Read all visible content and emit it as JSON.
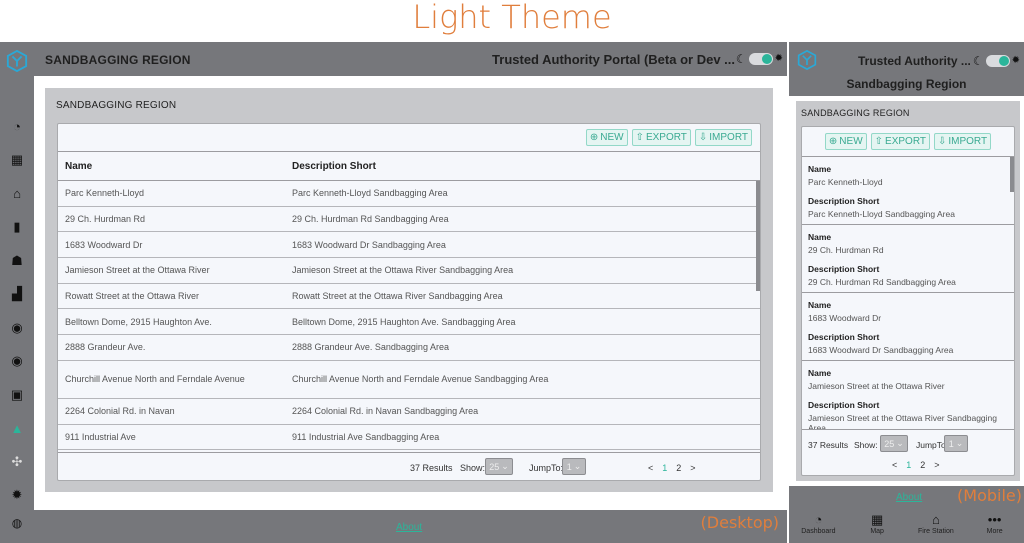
{
  "caption": "Light Theme",
  "desktop": {
    "header_title": "SANDBAGGING REGION",
    "portal_title": "Trusted Authority Portal (Beta or Dev ...",
    "theme_toggle": {
      "left_icon": "moon-icon",
      "right_icon": "sun-icon",
      "state": "light"
    },
    "sidebar": {
      "logo": "hex-y-logo",
      "items": [
        {
          "name": "dashboard",
          "icon": "speedometer-icon",
          "glyph": "◔"
        },
        {
          "name": "map",
          "icon": "map-icon",
          "glyph": "▦"
        },
        {
          "name": "fire-station",
          "icon": "fire-station-icon",
          "glyph": "⌂"
        },
        {
          "name": "fuel",
          "icon": "fuel-pump-icon",
          "glyph": "▮"
        },
        {
          "name": "people",
          "icon": "hand-people-icon",
          "glyph": "☗"
        },
        {
          "name": "city",
          "icon": "city-icon",
          "glyph": "▟"
        },
        {
          "name": "water",
          "icon": "water-drop-icon",
          "glyph": "◉"
        },
        {
          "name": "view",
          "icon": "eye-icon",
          "glyph": "◉"
        },
        {
          "name": "facility",
          "icon": "building-icon",
          "glyph": "▣"
        },
        {
          "name": "sandbagging",
          "icon": "sandbag-icon",
          "glyph": "▲",
          "active": true
        },
        {
          "name": "network",
          "icon": "network-icon",
          "glyph": "✣"
        },
        {
          "name": "settings",
          "icon": "gear-icon",
          "glyph": "✹"
        }
      ],
      "user_icon": "user-circle-icon",
      "user_glyph": "◍"
    },
    "card_title": "SANDBAGGING REGION",
    "buttons": {
      "new": "NEW",
      "export": "EXPORT",
      "import": "IMPORT",
      "new_glyph": "⊕",
      "export_glyph": "⇧",
      "import_glyph": "⇩"
    },
    "columns": {
      "name": "Name",
      "description": "Description Short"
    },
    "rows": [
      {
        "name": "Parc Kenneth-Lloyd",
        "description": "Parc Kenneth-Lloyd Sandbagging Area"
      },
      {
        "name": "29 Ch. Hurdman Rd",
        "description": "29 Ch. Hurdman Rd Sandbagging Area"
      },
      {
        "name": "1683 Woodward Dr",
        "description": "1683 Woodward Dr Sandbagging Area"
      },
      {
        "name": "Jamieson Street at the Ottawa River",
        "description": "Jamieson Street at the Ottawa River Sandbagging Area"
      },
      {
        "name": "Rowatt Street at the Ottawa River",
        "description": "Rowatt Street at the Ottawa River Sandbagging Area"
      },
      {
        "name": "Belltown Dome, 2915 Haughton Ave.",
        "description": "Belltown Dome, 2915 Haughton Ave. Sandbagging Area"
      },
      {
        "name": "2888 Grandeur Ave.",
        "description": "2888 Grandeur Ave. Sandbagging Area"
      },
      {
        "name": "Churchill Avenue North and Ferndale Avenue",
        "description": "Churchill Avenue North and Ferndale Avenue Sandbagging Area"
      },
      {
        "name": "2264 Colonial Rd. in Navan",
        "description": "2264 Colonial Rd. in Navan Sandbagging Area"
      },
      {
        "name": "911 Industrial Ave",
        "description": "911 Industrial Ave Sandbagging Area"
      }
    ],
    "footer": {
      "results": "37 Results",
      "show_label": "Show:",
      "show_value": "25",
      "jump_label": "JumpTo:",
      "jump_value": "1",
      "prev": "<",
      "pages": [
        "1",
        "2"
      ],
      "current_page": "1",
      "next": ">"
    },
    "about": "About",
    "label": "(Desktop)"
  },
  "mobile": {
    "portal_title": "Trusted Authority ...",
    "region_title": "Sandbagging Region",
    "card_title": "SANDBAGGING REGION",
    "items": [
      {
        "name": "Parc Kenneth-Lloyd",
        "description": "Parc Kenneth-Lloyd Sandbagging Area"
      },
      {
        "name": "29 Ch. Hurdman Rd",
        "description": "29 Ch. Hurdman Rd Sandbagging Area"
      },
      {
        "name": "1683 Woodward Dr",
        "description": "1683 Woodward Dr Sandbagging Area"
      },
      {
        "name": "Jamieson Street at the Ottawa River",
        "description": "Jamieson Street at the Ottawa River Sandbagging Area"
      }
    ],
    "nav": [
      {
        "label": "Dashboard",
        "icon": "speedometer-icon",
        "glyph": "◔"
      },
      {
        "label": "Map",
        "icon": "map-icon",
        "glyph": "▦"
      },
      {
        "label": "Fire Station",
        "icon": "fire-station-icon",
        "glyph": "⌂"
      },
      {
        "label": "More",
        "icon": "more-dots-icon",
        "glyph": "•••"
      }
    ],
    "about": "About",
    "label": "(Mobile)"
  },
  "colors": {
    "accent": "#2bb59a",
    "chrome": "#76777b",
    "card": "#c7c8cb",
    "annotation": "#e07e3c"
  }
}
